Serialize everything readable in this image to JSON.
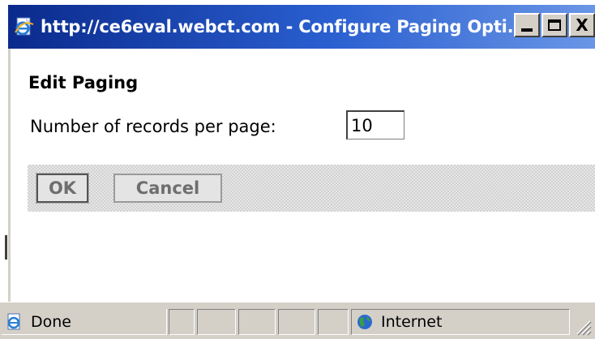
{
  "window": {
    "title": "http://ce6eval.webct.com - Configure Paging Opti...",
    "buttons": {
      "minimize": "minimize",
      "maximize": "maximize",
      "close": "X"
    }
  },
  "form": {
    "heading": "Edit Paging",
    "records_label": "Number of records per page:",
    "records_value": "10"
  },
  "actions": {
    "ok_label": "OK",
    "cancel_label": "Cancel"
  },
  "statusbar": {
    "status_text": "Done",
    "zone_text": "Internet"
  },
  "icons": {
    "title": "ie-page-icon",
    "status": "ie-page-icon",
    "zone": "globe-icon"
  },
  "colors": {
    "titlebar_start": "#0a2a8c",
    "titlebar_end": "#6a96e6",
    "chrome": "#d4d0c8"
  }
}
